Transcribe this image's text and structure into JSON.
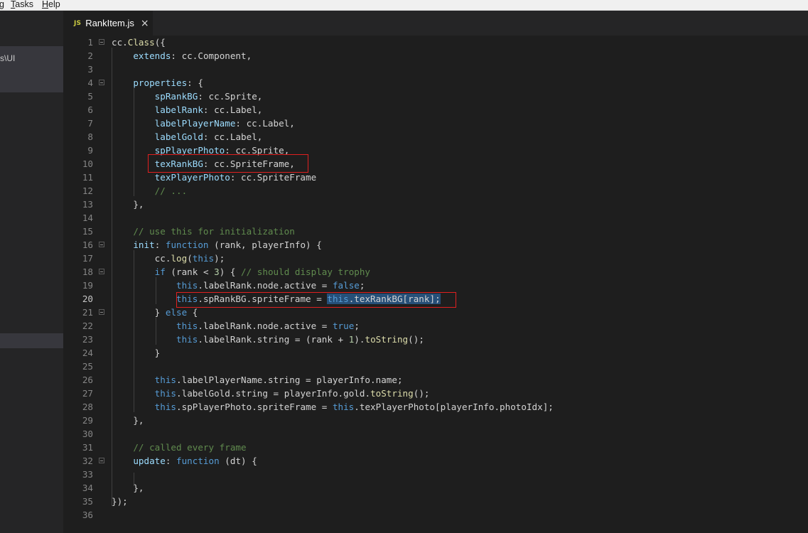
{
  "menu": {
    "items": [
      {
        "label": "g",
        "underline": "",
        "rest": ""
      },
      {
        "label": "",
        "underline": "T",
        "rest": "asks"
      },
      {
        "label": "",
        "underline": "H",
        "rest": "elp"
      }
    ]
  },
  "sidebar": {
    "folder_label": "s\\UI"
  },
  "tab": {
    "icon": "JS",
    "title": "RankItem.js",
    "close": "×"
  },
  "editor": {
    "current_line": 20,
    "lines": [
      {
        "n": "1",
        "code": "cc.Class({"
      },
      {
        "n": "2",
        "code": "    extends: cc.Component,"
      },
      {
        "n": "3",
        "code": ""
      },
      {
        "n": "4",
        "code": "    properties: {"
      },
      {
        "n": "5",
        "code": "        spRankBG: cc.Sprite,"
      },
      {
        "n": "6",
        "code": "        labelRank: cc.Label,"
      },
      {
        "n": "7",
        "code": "        labelPlayerName: cc.Label,"
      },
      {
        "n": "8",
        "code": "        labelGold: cc.Label,"
      },
      {
        "n": "9",
        "code": "        spPlayerPhoto: cc.Sprite,"
      },
      {
        "n": "10",
        "code": "        texRankBG: cc.SpriteFrame,"
      },
      {
        "n": "11",
        "code": "        texPlayerPhoto: cc.SpriteFrame"
      },
      {
        "n": "12",
        "code": "        // ..."
      },
      {
        "n": "13",
        "code": "    },"
      },
      {
        "n": "14",
        "code": ""
      },
      {
        "n": "15",
        "code": "    // use this for initialization"
      },
      {
        "n": "16",
        "code": "    init: function (rank, playerInfo) {"
      },
      {
        "n": "17",
        "code": "        cc.log(this);"
      },
      {
        "n": "18",
        "code": "        if (rank < 3) { // should display trophy"
      },
      {
        "n": "19",
        "code": "            this.labelRank.node.active = false;"
      },
      {
        "n": "20",
        "code": "            this.spRankBG.spriteFrame = this.texRankBG[rank];"
      },
      {
        "n": "21",
        "code": "        } else {"
      },
      {
        "n": "22",
        "code": "            this.labelRank.node.active = true;"
      },
      {
        "n": "23",
        "code": "            this.labelRank.string = (rank + 1).toString();"
      },
      {
        "n": "24",
        "code": "        }"
      },
      {
        "n": "25",
        "code": ""
      },
      {
        "n": "26",
        "code": "        this.labelPlayerName.string = playerInfo.name;"
      },
      {
        "n": "27",
        "code": "        this.labelGold.string = playerInfo.gold.toString();"
      },
      {
        "n": "28",
        "code": "        this.spPlayerPhoto.spriteFrame = this.texPlayerPhoto[playerInfo.photoIdx];"
      },
      {
        "n": "29",
        "code": "    },"
      },
      {
        "n": "30",
        "code": ""
      },
      {
        "n": "31",
        "code": "    // called every frame"
      },
      {
        "n": "32",
        "code": "    update: function (dt) {"
      },
      {
        "n": "33",
        "code": ""
      },
      {
        "n": "34",
        "code": "    },"
      },
      {
        "n": "35",
        "code": "});"
      },
      {
        "n": "36",
        "code": ""
      }
    ],
    "selected_text": "this.texRankBG[rank];"
  },
  "colors": {
    "keyword": "#569cd6",
    "comment": "#608b4e",
    "number": "#b5cea8",
    "function": "#dcdcaa",
    "property": "#9cdcfe",
    "text": "#d4d4d4",
    "highlight_box": "#e02020",
    "selection": "#264f78"
  }
}
